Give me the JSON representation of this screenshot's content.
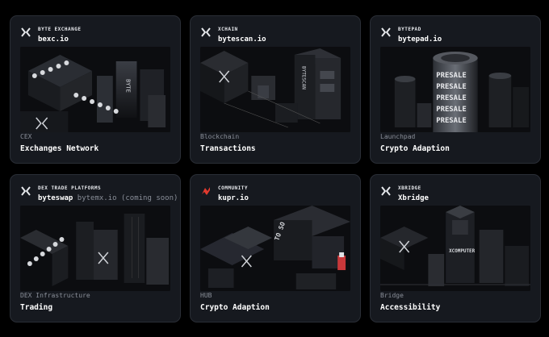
{
  "colors": {
    "background": "#000000",
    "card": "#16191f",
    "card_border": "#2a2e36",
    "muted_text": "#8a8f99",
    "accent_red": "#e23a2e"
  },
  "cards": [
    {
      "icon": "x-logo-icon",
      "category": "BYTE EXCHANGE",
      "domain": "bexc.io",
      "domain_extra": "",
      "footer_category": "CEX",
      "footer_title": "Exchanges Network"
    },
    {
      "icon": "x-logo-icon",
      "category": "XCHAIN",
      "domain": "bytescan.io",
      "domain_extra": "",
      "footer_category": "Blockchain",
      "footer_title": "Transactions"
    },
    {
      "icon": "x-logo-icon",
      "category": "BYTEPAD",
      "domain": "bytepad.io",
      "domain_extra": "",
      "footer_category": "Launchpad",
      "footer_title": "Crypto Adaption"
    },
    {
      "icon": "x-logo-icon",
      "category": "DEX TRADE PLATFORMS",
      "domain": "byteswap",
      "domain_extra": "bytemx.io (coming soon)",
      "footer_category": "DEX Infrastructure",
      "footer_title": "Trading"
    },
    {
      "icon": "kupr-logo-icon",
      "category": "COMMUNITY",
      "domain": "kupr.io",
      "domain_extra": "",
      "footer_category": "HUB",
      "footer_title": "Crypto Adaption"
    },
    {
      "icon": "x-logo-icon",
      "category": "XBRIDGE",
      "domain": "Xbridge",
      "domain_extra": "",
      "footer_category": "Bridge",
      "footer_title": "Accessibility"
    }
  ],
  "art_text": {
    "card1_tower": "BYTE",
    "card2_tower": "BYTESCAN",
    "card3_cylinder": "PRESALE",
    "card5_sign": "TO SO",
    "card6_sign": "XCOMPUTER"
  }
}
